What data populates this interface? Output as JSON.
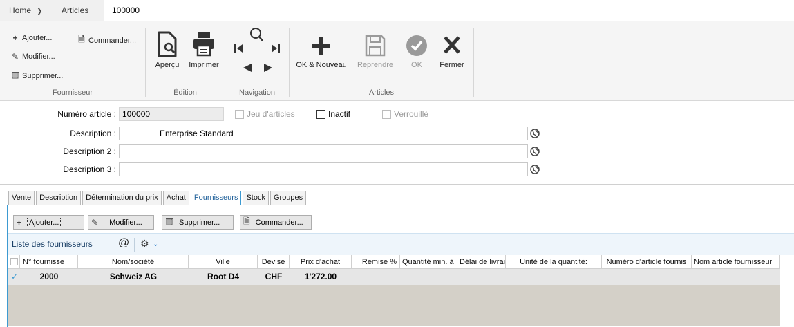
{
  "top_tabs": {
    "home": "Home",
    "articles": "Articles",
    "active": "100000"
  },
  "ribbon": {
    "fournisseur": {
      "ajouter": "Ajouter...",
      "commander": "Commander...",
      "modifier": "Modifier...",
      "supprimer": "Supprimer...",
      "label": "Fournisseur"
    },
    "edition": {
      "apercu": "Aperçu",
      "imprimer": "Imprimer",
      "label": "Édition"
    },
    "navigation": {
      "label": "Navigation"
    },
    "articles": {
      "ok_nouveau": "OK & Nouveau",
      "reprendre": "Reprendre",
      "ok": "OK",
      "fermer": "Fermer",
      "label": "Articles"
    }
  },
  "form": {
    "numero_label": "Numéro article :",
    "numero_value": "100000",
    "jeu_articles": "Jeu d'articles",
    "inactif": "Inactif",
    "verrouille": "Verrouillé",
    "description_label": "Description :",
    "description_value": "Enterprise Standard",
    "description2_label": "Description 2 :",
    "description2_value": "",
    "description3_label": "Description 3 :",
    "description3_value": ""
  },
  "tabs": [
    "Vente",
    "Description",
    "Détermination du prix",
    "Achat",
    "Fournisseurs",
    "Stock",
    "Groupes"
  ],
  "panel": {
    "buttons": {
      "ajouter": "Ajouter...",
      "modifier": "Modifier...",
      "supprimer": "Supprimer...",
      "commander": "Commander..."
    },
    "list_title": "Liste des fournisseurs",
    "columns": [
      "N° fournisse",
      "Nom/société",
      "Ville",
      "Devise",
      "Prix d'achat",
      "Remise %",
      "Quantité min. à",
      "Délai de livrai",
      "Unité de la quantité:",
      "Numéro d'article fournis",
      "Nom article fournisseur"
    ],
    "rows": [
      {
        "numero": "2000",
        "nom": "Schweiz AG",
        "ville": "Root D4",
        "devise": "CHF",
        "prix": "1'272.00"
      }
    ]
  },
  "colors": {
    "accent": "#3d9ad1",
    "grid_empty": "#d4d0c8",
    "selected_row": "#e6e6e6"
  }
}
